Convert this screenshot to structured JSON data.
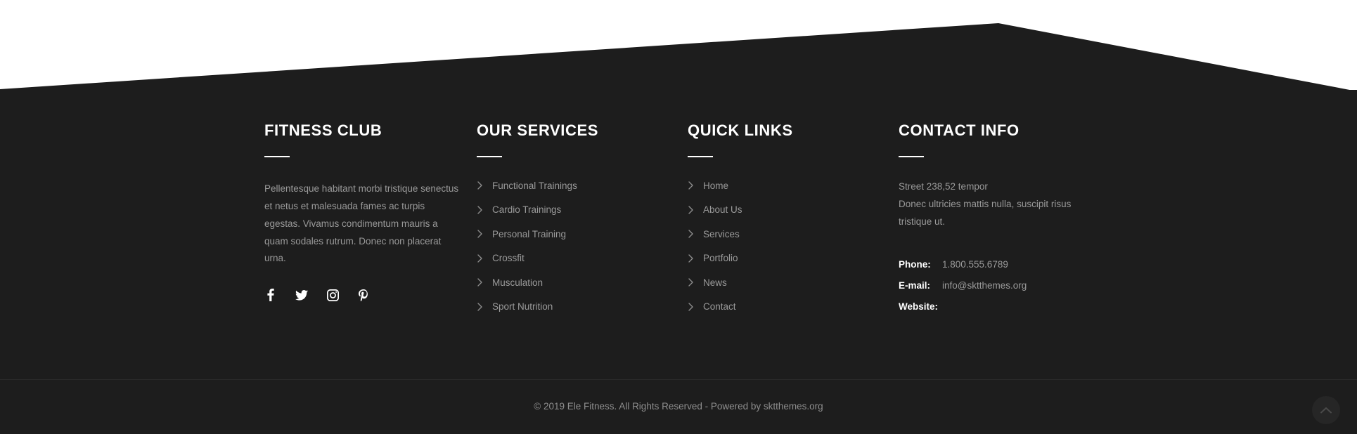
{
  "theme": {
    "footer_bg": "#1d1d1d",
    "page_bg": "#ffffff",
    "heading_color": "#ffffff",
    "body_text_color": "#9a9a9a",
    "rule_color": "#ffffff"
  },
  "footer": {
    "brand": {
      "title": "FITNESS CLUB",
      "description": "Pellentesque habitant morbi tristique senectus et netus et malesuada fames ac turpis egestas. Vivamus condimentum mauris a quam sodales rutrum. Donec non placerat urna.",
      "social": [
        {
          "name": "facebook-icon",
          "label": "Facebook"
        },
        {
          "name": "twitter-icon",
          "label": "Twitter"
        },
        {
          "name": "instagram-icon",
          "label": "Instagram"
        },
        {
          "name": "pinterest-icon",
          "label": "Pinterest"
        }
      ]
    },
    "services": {
      "title": "OUR SERVICES",
      "items": [
        {
          "label": "Functional Trainings"
        },
        {
          "label": "Cardio Trainings"
        },
        {
          "label": "Personal Training"
        },
        {
          "label": "Crossfit"
        },
        {
          "label": "Musculation"
        },
        {
          "label": "Sport Nutrition"
        }
      ]
    },
    "quick_links": {
      "title": "QUICK LINKS",
      "items": [
        {
          "label": "Home"
        },
        {
          "label": "About Us"
        },
        {
          "label": "Services"
        },
        {
          "label": "Portfolio"
        },
        {
          "label": "News"
        },
        {
          "label": "Contact"
        }
      ]
    },
    "contact": {
      "title": "CONTACT INFO",
      "address_lines": [
        "Street 238,52 tempor",
        "Donec ultricies mattis nulla, suscipit risus",
        "tristique ut."
      ],
      "rows": [
        {
          "label": "Phone:",
          "value": "1.800.555.6789"
        },
        {
          "label": "E-mail:",
          "value": "info@sktthemes.org"
        },
        {
          "label": "Website:",
          "value": ""
        }
      ]
    },
    "copyright": "© 2019 Ele Fitness. All Rights Reserved - Powered by sktthemes.org",
    "scroll_top": {
      "name": "chevron-up-icon",
      "label": "Back to top"
    }
  }
}
